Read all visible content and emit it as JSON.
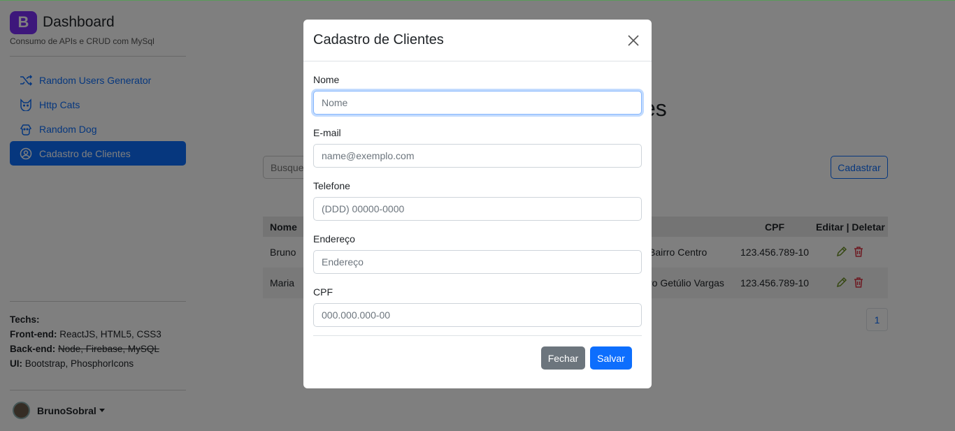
{
  "sidebar": {
    "brand_letter": "B",
    "brand_title": "Dashboard",
    "brand_subtitle": "Consumo de APIs e CRUD com MySql",
    "items": [
      {
        "label": "Random Users Generator",
        "icon": "shuffle-icon"
      },
      {
        "label": "Http Cats",
        "icon": "cat-icon"
      },
      {
        "label": "Random Dog",
        "icon": "dog-icon"
      },
      {
        "label": "Cadastro de Clientes",
        "icon": "user-gear-icon"
      }
    ],
    "techs_title": "Techs:",
    "frontend_label": "Front-end:",
    "frontend_value": "ReactJS, HTML5, CSS3",
    "backend_label": "Back-end:",
    "backend_value": "Node, Firebase, MySQL",
    "ui_label": "UI:",
    "ui_value": "Bootstrap, PhosphorIcons",
    "user_name": "BrunoSobral"
  },
  "main": {
    "title_visible": "es",
    "search_placeholder": "Busque",
    "register_button": "Cadastrar",
    "table": {
      "headers": {
        "nome": "Nome",
        "cpf": "CPF",
        "actions": "Editar | Deletar"
      },
      "rows": [
        {
          "nome": "Bruno",
          "endereco": "Bairro Centro",
          "cpf": "123.456.789-10"
        },
        {
          "nome": "Maria",
          "endereco": "ro Getúlio Vargas",
          "cpf": "123.456.789-10"
        }
      ]
    },
    "page": "1"
  },
  "modal": {
    "title": "Cadastro de Clientes",
    "fields": [
      {
        "label": "Nome",
        "placeholder": "Nome"
      },
      {
        "label": "E-mail",
        "placeholder": "name@exemplo.com"
      },
      {
        "label": "Telefone",
        "placeholder": "(DDD) 00000-0000"
      },
      {
        "label": "Endereço",
        "placeholder": "Endereço"
      },
      {
        "label": "CPF",
        "placeholder": "000.000.000-00"
      }
    ],
    "close_label": "Fechar",
    "save_label": "Salvar"
  },
  "colors": {
    "primary": "#0d6efd",
    "brand": "#7b2ff7",
    "secondary": "#6c757d",
    "danger": "#dc3545",
    "edit": "#6b8e23"
  }
}
